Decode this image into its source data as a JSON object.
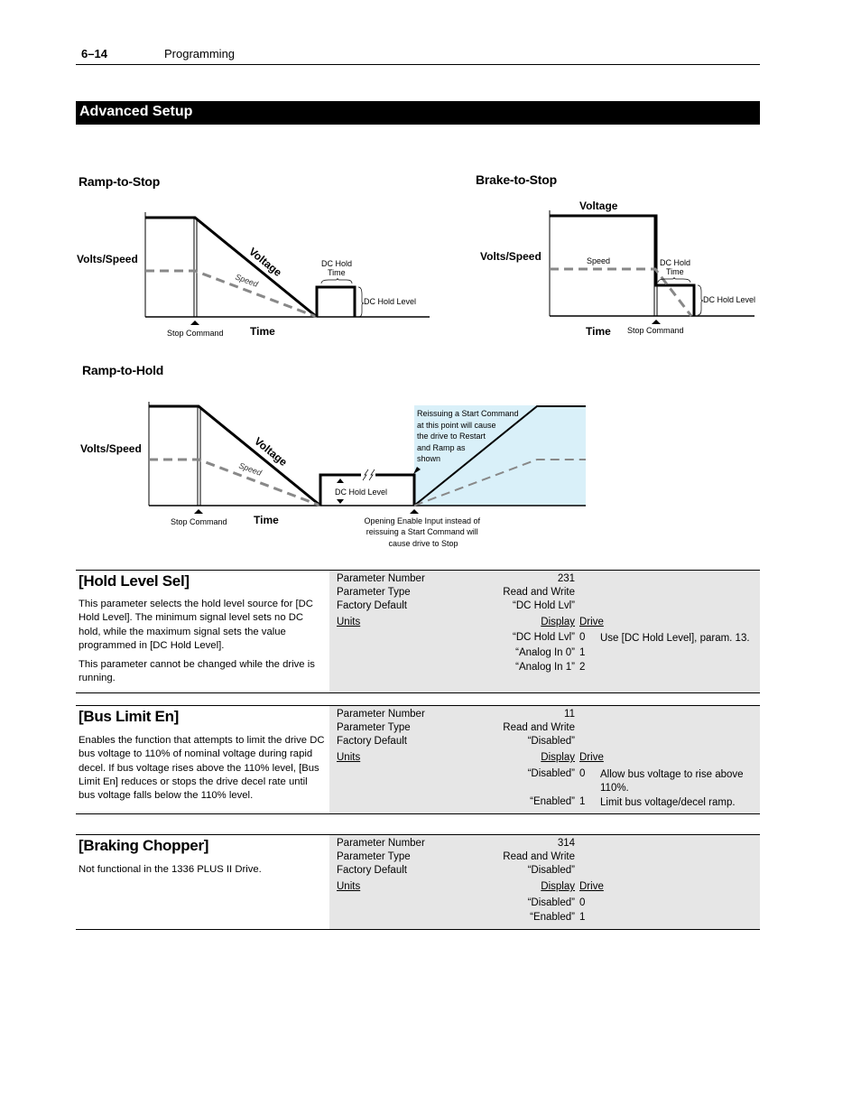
{
  "page_header": {
    "page_number": "6–14",
    "chapter": "Programming"
  },
  "section": {
    "title": "Advanced Setup"
  },
  "diagrams": {
    "ramp_to_stop": {
      "title": "Ramp-to-Stop",
      "y_label": "Volts/Speed",
      "x_label": "Time",
      "voltage_label": "Voltage",
      "speed_label": "Speed",
      "stop_command": "Stop Command",
      "dc_hold_time_line1": "DC Hold",
      "dc_hold_time_line2": "Time",
      "dc_hold_level": "DC Hold Level"
    },
    "brake_to_stop": {
      "title": "Brake-to-Stop",
      "y_label": "Volts/Speed",
      "x_label": "Time",
      "voltage_label": "Voltage",
      "speed_label": "Speed",
      "stop_command": "Stop Command",
      "dc_hold_time_line1": "DC Hold",
      "dc_hold_time_line2": "Time",
      "dc_hold_level": "DC Hold Level"
    },
    "ramp_to_hold": {
      "title": "Ramp-to-Hold",
      "y_label": "Volts/Speed",
      "x_label": "Time",
      "voltage_label": "Voltage",
      "speed_label": "Speed",
      "stop_command": "Stop Command",
      "dc_hold_level": "DC Hold Level",
      "restart_note": [
        "Reissuing a Start Command",
        "at this point will cause",
        "the drive to Restart",
        "and Ramp as",
        "shown"
      ],
      "stop_note": [
        "Opening Enable Input instead of",
        "reissuing a Start Command will",
        "cause drive to Stop"
      ],
      "restart_region_color": "#d9f0f9"
    }
  },
  "labels": {
    "parameter_number": "Parameter Number",
    "parameter_type": "Parameter Type",
    "factory_default": "Factory Default",
    "units": "Units",
    "display": "Display",
    "drive": "Drive"
  },
  "parameters": [
    {
      "name": "[Hold Level Sel]",
      "description": [
        "This parameter selects the hold level source for [DC Hold Level]. The minimum signal level sets no DC hold, while the maximum signal sets the value programmed in [DC Hold Level].",
        "This parameter cannot be changed while the drive is running."
      ],
      "number": "231",
      "type": "Read and Write",
      "default": "“DC Hold Lvl”",
      "options": [
        {
          "display": "“DC Hold Lvl”",
          "drive": "0",
          "desc": "Use [DC Hold Level], param. 13."
        },
        {
          "display": "“Analog In 0”",
          "drive": "1",
          "desc": ""
        },
        {
          "display": "“Analog In 1”",
          "drive": "2",
          "desc": ""
        }
      ]
    },
    {
      "name": "[Bus Limit En]",
      "description": [
        "Enables the function that attempts to limit the drive DC bus voltage to 110% of nominal voltage during rapid decel. If bus voltage rises above the 110% level, [Bus Limit En] reduces or stops the drive decel rate until bus voltage falls below the 110% level."
      ],
      "number": "11",
      "type": "Read and Write",
      "default": "“Disabled”",
      "options": [
        {
          "display": "“Disabled”",
          "drive": "0",
          "desc": "Allow bus voltage to rise above 110%."
        },
        {
          "display": "“Enabled”",
          "drive": "1",
          "desc": "Limit bus voltage/decel ramp."
        }
      ]
    },
    {
      "name": "[Braking Chopper]",
      "description": [
        "Not functional in the 1336 PLUS II Drive."
      ],
      "number": "314",
      "type": "Read and Write",
      "default": "“Disabled”",
      "options": [
        {
          "display": "“Disabled”",
          "drive": "0",
          "desc": ""
        },
        {
          "display": "“Enabled”",
          "drive": "1",
          "desc": ""
        }
      ]
    }
  ]
}
